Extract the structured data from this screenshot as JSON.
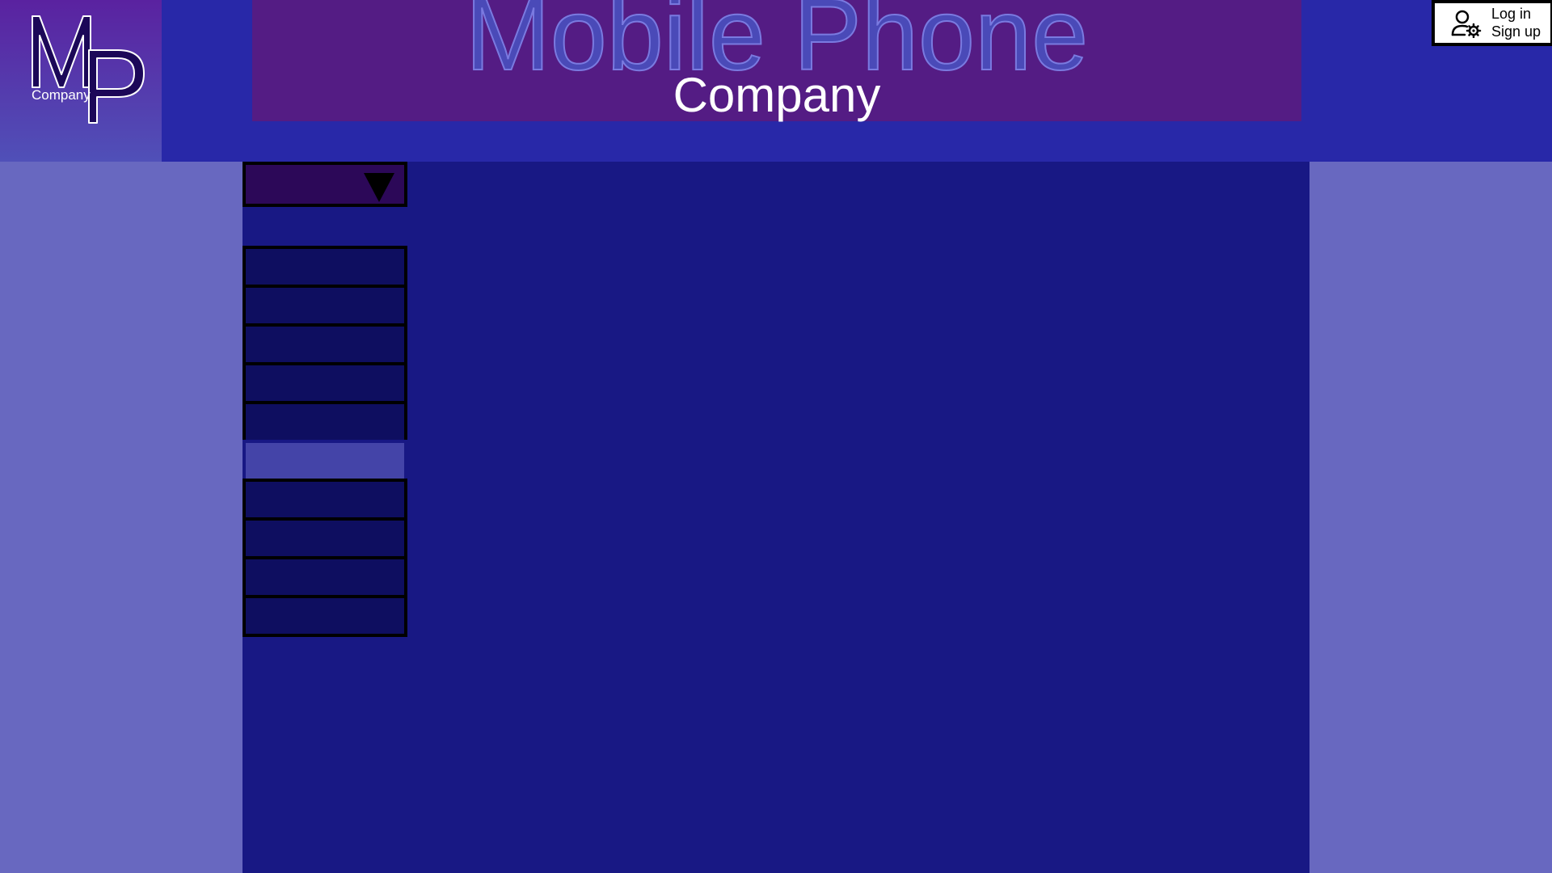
{
  "logo": {
    "monogram": "MP",
    "caption": "Company"
  },
  "banner": {
    "title": "Mobile Phone",
    "subtitle": "Company"
  },
  "account": {
    "icon": "user-gear-icon",
    "login_label": "Log in",
    "signup_label": "Sign up"
  },
  "dropdown": {
    "icon": "triangle-down-icon",
    "selected": ""
  },
  "menu": {
    "items": [
      {
        "label": "",
        "active": false
      },
      {
        "label": "",
        "active": false
      },
      {
        "label": "",
        "active": false
      },
      {
        "label": "",
        "active": false
      },
      {
        "label": "",
        "active": false
      },
      {
        "label": "",
        "active": true
      },
      {
        "label": "",
        "active": false
      },
      {
        "label": "",
        "active": false
      },
      {
        "label": "",
        "active": false
      },
      {
        "label": "",
        "active": false
      }
    ]
  },
  "colors": {
    "header_bg": "#2828a8",
    "banner_bg": "#541c84",
    "page_bg": "#6868c0",
    "main_panel_bg": "#181884",
    "dropdown_bg": "#2c0858",
    "menu_item_bg": "#0e0e60",
    "menu_item_active_bg": "#4444a8",
    "title_color": "#4a4ab8"
  }
}
